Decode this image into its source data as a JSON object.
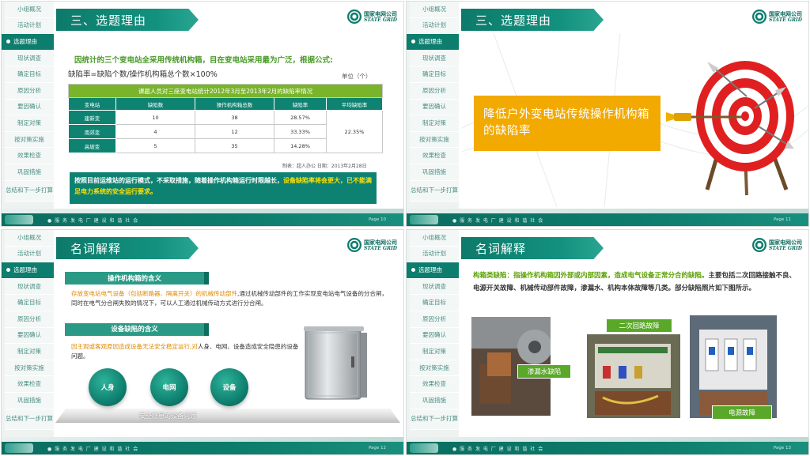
{
  "sidebar": {
    "items": [
      "小组概况",
      "活动计划",
      "选题理由",
      "现状调查",
      "确定目标",
      "原因分析",
      "要因确认",
      "制定对策",
      "按对策实施",
      "效果检查",
      "巩固措施",
      "总结和下一步打算"
    ],
    "active_index": 2
  },
  "logo": {
    "cn": "国家电网公司",
    "en": "STATE GRID"
  },
  "footer": {
    "slogan": "● 服 务 发 电 厂   建 设 和 谐 社 会"
  },
  "slides": [
    {
      "title": "三、选题理由",
      "page": "Page 10",
      "intro": "因统计的三个变电站全采用传统机构箱，目在变电站采用最为广泛，根据公式:",
      "formula": "缺陷率=缺陷个数/操作机构箱总个数×100%",
      "unit": "单位（个）",
      "table": {
        "caption": "课题人员对三座变电站统计2012年3月至2013年2月的缺陷率情况",
        "headers": [
          "变电站",
          "缺陷数",
          "操作机构箱总数",
          "缺陷率",
          "平均缺陷率"
        ],
        "rows": [
          [
            "建新变",
            "10",
            "38",
            "28.57%"
          ],
          [
            "南郊变",
            "4",
            "12",
            "33.33%"
          ],
          [
            "高坡变",
            "5",
            "35",
            "14.28%"
          ]
        ],
        "average": "22.35%"
      },
      "note": "制表：超人办公  日期：2013年2月28日",
      "box_text": "按照目前运维站的运行模式，不采取措施，随着操作机构箱运行时限越长，",
      "box_highlight": "设备缺陷率将会更大，已不能满足电力系统的安全运行要求。"
    },
    {
      "title": "三、选题理由",
      "page": "Page 11",
      "goal": "降低户外变电站传统操作机构箱的缺陷率"
    },
    {
      "title": "名词解释",
      "page": "Page 12",
      "h1": "操作机构箱的含义",
      "p1_highlight": "存放变电站电气设备（包括断路器、隔离开关）的机械传动部件",
      "p1_rest": ",通过机械传动部件的工作实现变电站电气设备的分合闸，同时在电气分合闸失败的情况下，可以人工通过机械传动方式进行分合闸。",
      "h2": "设备缺陷的含义",
      "p2_highlight": "因主观或客观原因造成设备无法安全稳定运行,对",
      "p2_rest": "人身、电网、设备造成安全隐患的设备问题。",
      "circles": [
        "人身",
        "电网",
        "设备"
      ],
      "platform_label": "安全隐患的设备问题"
    },
    {
      "title": "名词解释",
      "page": "Page 13",
      "text_highlight": "构箱类缺陷：指操作机构箱因外部或内部因素，造成电气设备正常分合的缺陷。",
      "text_rest": "主要包括二次回路接触不良、电源开关故障、机械传动部件故障，渗漏水、机构本体故障等几类。部分缺陷照片如下图所示。",
      "photos": [
        "渗漏水缺陷",
        "二次回路故障",
        "电源故障"
      ]
    }
  ]
}
